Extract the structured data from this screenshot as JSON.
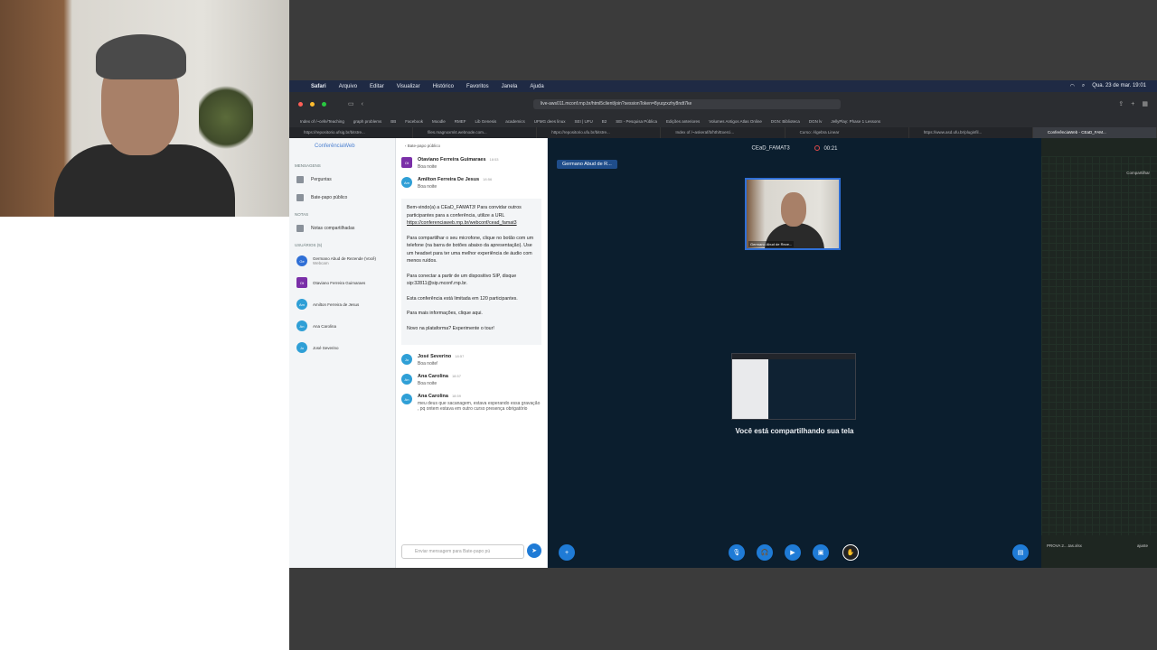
{
  "menubar": {
    "app": "Safari",
    "items": [
      "Arquivo",
      "Editar",
      "Visualizar",
      "Histórico",
      "Favoritos",
      "Janela",
      "Ajuda"
    ],
    "clock": "Qua. 23 de mar. 19:01"
  },
  "browser": {
    "url": "live-aws011.mconf.rnp.br/html5client/join?sessionToken=8yuqzxzhy8ndt7ke",
    "bookmarks": [
      "Index of /~cefe/Teaching",
      "graph problems",
      "BB",
      "Facebook",
      "Moodle",
      "RMEF",
      "Lib Genesis",
      "academics",
      "UFMG dees linux",
      "SEI | UFU",
      "B2",
      "SEI - Pesquisa Pública",
      "Edições anteriores",
      "Volumes Antigos Atlas Online",
      "DGN: Biblioteca",
      "DGN lv",
      "JellyPlay: Phase 1 Lessons"
    ],
    "tabs": [
      "https://repositorio.ufsig.br/bitstre...",
      "files.magnoxml4.webnode.com...",
      "https://repositorio.ufu.br/bitstre...",
      "Index of /~askeraf/b/hth/Exerci...",
      "Curso: Álgebra Linear",
      "https://www.asd.ufu.br/pluginfil...",
      "ConferênciaWeb - CEaD_FAM..."
    ]
  },
  "userpanel": {
    "logo": "ConferênciaWeb",
    "messages_heading": "MENSAGENS",
    "item_questions": "Perguntas",
    "item_public_chat": "Bate-papo público",
    "notes_heading": "NOTAS",
    "item_shared_notes": "Notas compartilhadas",
    "users_heading": "USUÁRIOS (5)",
    "users": [
      {
        "initials": "Ge",
        "name": "Germano Abud de Rezende (Você)",
        "sub": "Webcam",
        "color": "#2f6fd6"
      },
      {
        "initials": "Ot",
        "name": "Otaviano Ferreira Guimaraes",
        "sub": "",
        "color": "#7a2fa8"
      },
      {
        "initials": "Am",
        "name": "Amilton Ferreira de Jesus",
        "sub": "",
        "color": "#2f9fd6"
      },
      {
        "initials": "An",
        "name": "Ana Carolina",
        "sub": "",
        "color": "#2f9fd6"
      },
      {
        "initials": "Jo",
        "name": "José Severino",
        "sub": "",
        "color": "#2f9fd6"
      }
    ]
  },
  "chat": {
    "header": "Bate-papo público",
    "messages_top": [
      {
        "initials": "Ot",
        "name": "Otaviano Ferreira Guimaraes",
        "time": "18:53",
        "text": "Boa noite",
        "color": "#7a2fa8"
      },
      {
        "initials": "Am",
        "name": "Amilton Ferreira De Jesus",
        "time": "18:56",
        "text": "Boa noite",
        "color": "#2f9fd6"
      }
    ],
    "welcome": {
      "p1": "Bem-vindo(a) a CEaD_FAMAT3! Para convidar outros participantes para a conferência, utilize a URL",
      "p1_link": "https://conferenciaweb.rnp.br/webconf/cead_famat3",
      "p2": "Para compartilhar o seu microfone, clique no botão com um telefone (na barra de botões abaixo da apresentação). Use um headset para ter uma melhor experiência de áudio com menos ruídos.",
      "p3": "Para conectar a partir de um dispositivo SIP, disque sip:32811@sip.mconf.rnp.br.",
      "p4": "Esta conferência está limitada em 120 participantes.",
      "p5": "Para mais informações, clique aqui.",
      "p6": "Novo na plataforma? Experimente o tour!"
    },
    "messages_bottom": [
      {
        "initials": "Jo",
        "name": "José Severino",
        "time": "18:57",
        "text": "Boa noite!",
        "color": "#2f9fd6"
      },
      {
        "initials": "An",
        "name": "Ana Carolina",
        "time": "18:57",
        "text": "Boa noite",
        "color": "#2f9fd6"
      },
      {
        "initials": "An",
        "name": "Ana Carolina",
        "time": "18:59",
        "text": "meu deus que sacanagem, estava esperando essa gravação , pq ontem estava em outro curso presença obrigatório",
        "color": "#2f9fd6"
      }
    ],
    "input_placeholder": "Enviar mensagem para Bate-papo pú"
  },
  "stage": {
    "room": "CEaD_FAMAT3",
    "timer": "00:21",
    "presenter_tag": "Germano Abud de R...",
    "cam_label": "Germano Abud de Reze...",
    "share_text": "Você está compartilhando sua tela"
  },
  "rightpane": {
    "share": "Compartilhar",
    "footer_left": "PROVA 2....tas.xlsx",
    "footer_right": "ajuste"
  }
}
